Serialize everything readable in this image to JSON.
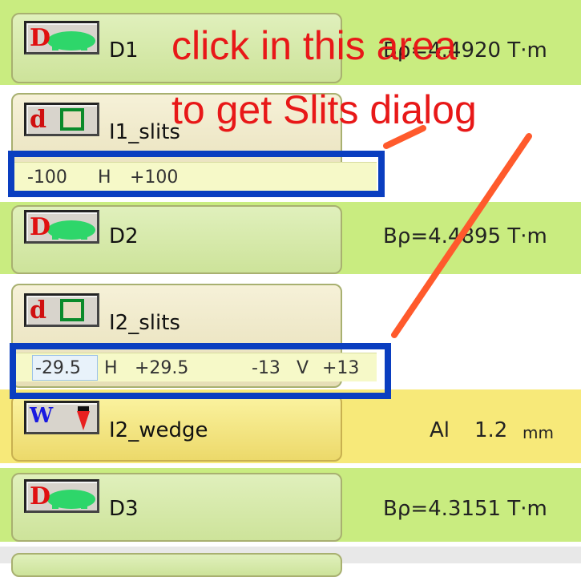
{
  "colors": {
    "annotation": "#e81818",
    "highlight_box": "#0a3ec0",
    "row_green": "#c9ec80"
  },
  "annotation": {
    "line1": "click in this area",
    "line2": "to get Slits dialog"
  },
  "elements": {
    "d1": {
      "name": "D1",
      "info": "Bρ=4.4920 T·m",
      "icon": "dipole-magnet-icon",
      "icon_letter": "D"
    },
    "i1": {
      "name": "I1_slits",
      "icon": "slits-icon",
      "icon_letter": "d",
      "slit_h_min": "-100",
      "slit_h_label": "H",
      "slit_h_max": "+100"
    },
    "d2": {
      "name": "D2",
      "info": "Bρ=4.4895 T·m",
      "icon": "dipole-magnet-icon",
      "icon_letter": "D"
    },
    "i2": {
      "name": "I2_slits",
      "icon": "slits-icon",
      "icon_letter": "d",
      "slit_h_min": "-29.5",
      "slit_h_label": "H",
      "slit_h_max": "+29.5",
      "slit_v_min": "-13",
      "slit_v_label": "V",
      "slit_v_max": "+13"
    },
    "wedge": {
      "name": "I2_wedge",
      "material": "Al",
      "thickness": "1.2",
      "unit": "mm",
      "icon": "wedge-icon",
      "icon_letter": "W"
    },
    "d3": {
      "name": "D3",
      "info": "Bρ=4.3151 T·m",
      "icon": "dipole-magnet-icon",
      "icon_letter": "D"
    }
  }
}
